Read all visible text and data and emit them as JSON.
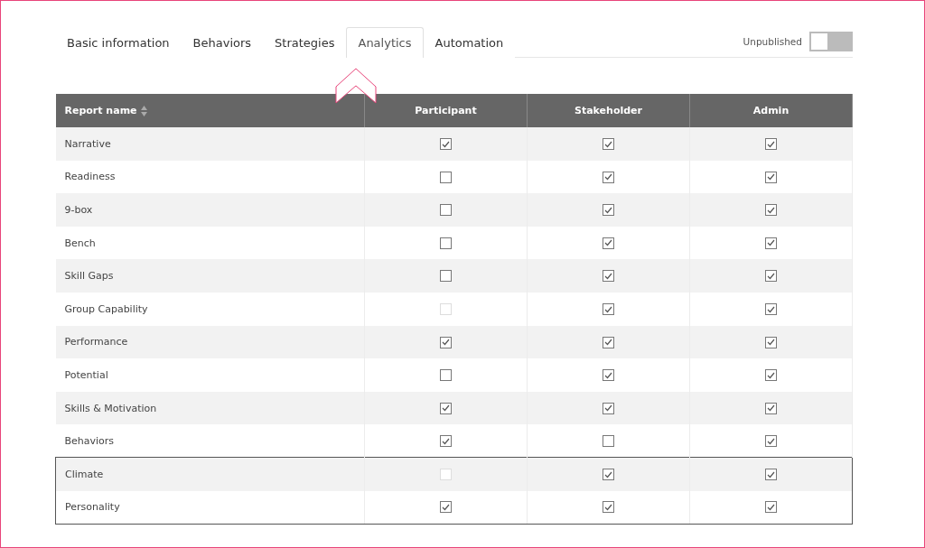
{
  "tabs": [
    {
      "label": "Basic information",
      "selected": false
    },
    {
      "label": "Behaviors",
      "selected": false
    },
    {
      "label": "Strategies",
      "selected": false
    },
    {
      "label": "Analytics",
      "selected": true
    },
    {
      "label": "Automation",
      "selected": false
    }
  ],
  "publish": {
    "label": "Unpublished",
    "on": false
  },
  "table": {
    "columns": [
      "Report name",
      "Participant",
      "Stakeholder",
      "Admin"
    ],
    "rows": [
      {
        "name": "Narrative",
        "outlined": false,
        "cells": [
          {
            "checked": true,
            "disabled": false
          },
          {
            "checked": true,
            "disabled": false
          },
          {
            "checked": true,
            "disabled": false
          }
        ]
      },
      {
        "name": "Readiness",
        "outlined": false,
        "cells": [
          {
            "checked": false,
            "disabled": false
          },
          {
            "checked": true,
            "disabled": false
          },
          {
            "checked": true,
            "disabled": false
          }
        ]
      },
      {
        "name": "9-box",
        "outlined": false,
        "cells": [
          {
            "checked": false,
            "disabled": false
          },
          {
            "checked": true,
            "disabled": false
          },
          {
            "checked": true,
            "disabled": false
          }
        ]
      },
      {
        "name": "Bench",
        "outlined": false,
        "cells": [
          {
            "checked": false,
            "disabled": false
          },
          {
            "checked": true,
            "disabled": false
          },
          {
            "checked": true,
            "disabled": false
          }
        ]
      },
      {
        "name": "Skill Gaps",
        "outlined": false,
        "cells": [
          {
            "checked": false,
            "disabled": false
          },
          {
            "checked": true,
            "disabled": false
          },
          {
            "checked": true,
            "disabled": false
          }
        ]
      },
      {
        "name": "Group Capability",
        "outlined": false,
        "cells": [
          {
            "checked": false,
            "disabled": true
          },
          {
            "checked": true,
            "disabled": false
          },
          {
            "checked": true,
            "disabled": false
          }
        ]
      },
      {
        "name": "Performance",
        "outlined": false,
        "cells": [
          {
            "checked": true,
            "disabled": false
          },
          {
            "checked": true,
            "disabled": false
          },
          {
            "checked": true,
            "disabled": false
          }
        ]
      },
      {
        "name": "Potential",
        "outlined": false,
        "cells": [
          {
            "checked": false,
            "disabled": false
          },
          {
            "checked": true,
            "disabled": false
          },
          {
            "checked": true,
            "disabled": false
          }
        ]
      },
      {
        "name": "Skills & Motivation",
        "outlined": false,
        "cells": [
          {
            "checked": true,
            "disabled": false
          },
          {
            "checked": true,
            "disabled": false
          },
          {
            "checked": true,
            "disabled": false
          }
        ]
      },
      {
        "name": "Behaviors",
        "outlined": false,
        "cells": [
          {
            "checked": true,
            "disabled": false
          },
          {
            "checked": false,
            "disabled": false
          },
          {
            "checked": true,
            "disabled": false
          }
        ]
      },
      {
        "name": "Climate",
        "outlined": true,
        "cells": [
          {
            "checked": false,
            "disabled": true
          },
          {
            "checked": true,
            "disabled": false
          },
          {
            "checked": true,
            "disabled": false
          }
        ]
      },
      {
        "name": "Personality",
        "outlined": true,
        "cells": [
          {
            "checked": true,
            "disabled": false
          },
          {
            "checked": true,
            "disabled": false
          },
          {
            "checked": true,
            "disabled": false
          }
        ]
      }
    ]
  }
}
